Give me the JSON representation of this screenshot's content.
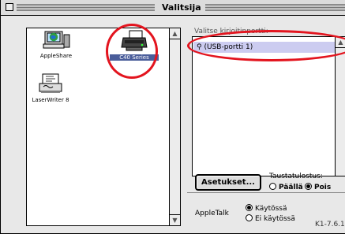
{
  "window": {
    "title": "Valitsija"
  },
  "icons": [
    {
      "name": "AppleShare",
      "icon": "appleshare-icon"
    },
    {
      "name": "C40 Series",
      "icon": "printer-icon",
      "selected": true
    },
    {
      "name": "LaserWriter 8",
      "icon": "laserwriter-icon"
    }
  ],
  "port_list": {
    "label": "Valitse kirjoitinportti:",
    "items": [
      "(USB-portti 1)"
    ],
    "icon": "usb-icon"
  },
  "setup_button": {
    "label": "Asetukset..."
  },
  "background_printing": {
    "label": "Taustatulostus:",
    "on": "Päällä",
    "off": "Pois",
    "selected": "off"
  },
  "appletalk": {
    "label": "AppleTalk",
    "active": "Käytössä",
    "inactive": "Ei käytössä",
    "selected": "active"
  },
  "version": "K1-7.6.1",
  "colors": {
    "highlight": "#ccccf0",
    "annotation": "#e3141e"
  }
}
